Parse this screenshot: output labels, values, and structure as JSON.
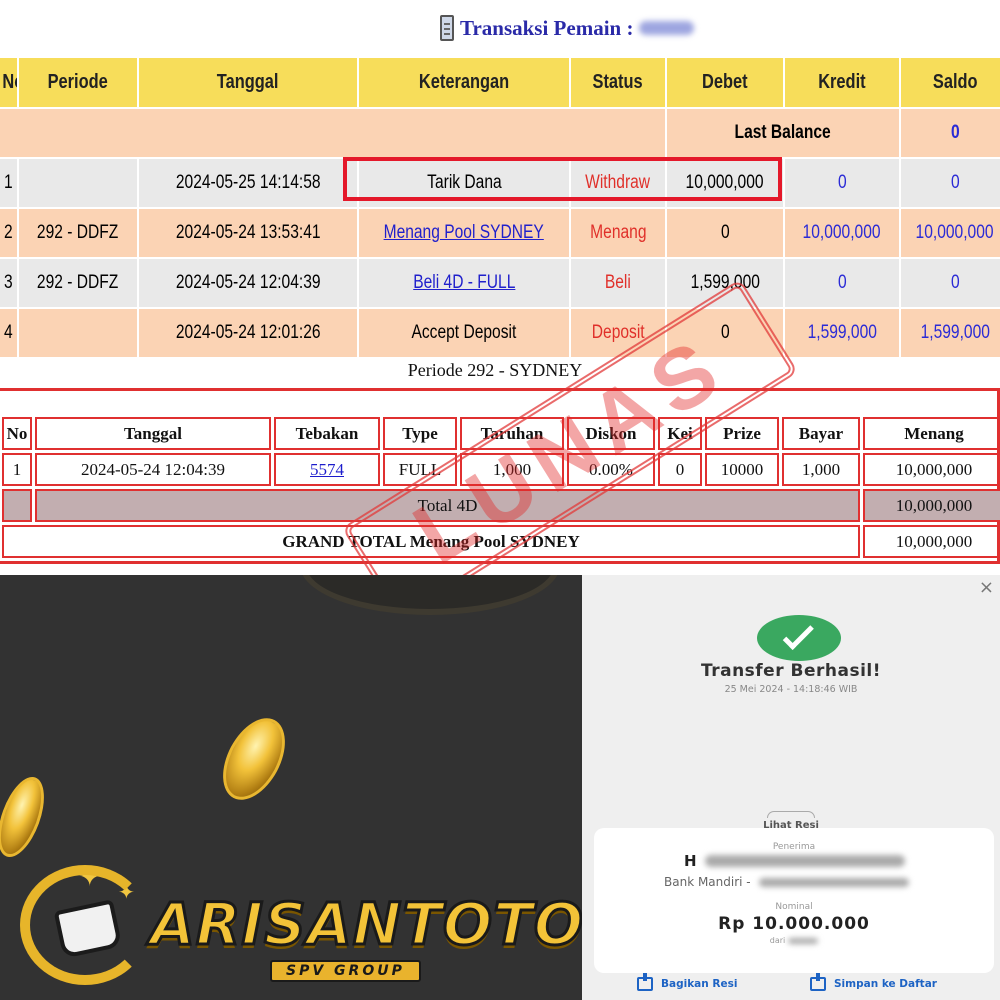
{
  "header": {
    "title": "Transaksi  Pemain :"
  },
  "transactions": {
    "columns": [
      "No",
      "Periode",
      "Tanggal",
      "Keterangan",
      "Status",
      "Debet",
      "Kredit",
      "Saldo"
    ],
    "last_balance_label": "Last Balance",
    "last_balance_value": "0",
    "rows": [
      {
        "no": "1",
        "periode": "",
        "tanggal": "2024-05-25 14:14:58",
        "keterangan": "Tarik Dana",
        "status": "Withdraw",
        "debet": "10,000,000",
        "kredit": "0",
        "saldo": "0"
      },
      {
        "no": "2",
        "periode": "292 - DDFZ",
        "tanggal": "2024-05-24 13:53:41",
        "keterangan": "Menang Pool SYDNEY",
        "status": "Menang",
        "debet": "0",
        "kredit": "10,000,000",
        "saldo": "10,000,000"
      },
      {
        "no": "3",
        "periode": "292 - DDFZ",
        "tanggal": "2024-05-24 12:04:39",
        "keterangan": "Beli 4D - FULL",
        "status": "Beli",
        "debet": "1,599,000",
        "kredit": "0",
        "saldo": "0"
      },
      {
        "no": "4",
        "periode": "",
        "tanggal": "2024-05-24 12:01:26",
        "keterangan": "Accept Deposit",
        "status": "Deposit",
        "debet": "0",
        "kredit": "1,599,000",
        "saldo": "1,599,000"
      }
    ]
  },
  "detail": {
    "title": "Periode 292 - SYDNEY",
    "columns": [
      "No",
      "Tanggal",
      "Tebakan",
      "Type",
      "Taruhan",
      "Diskon",
      "Kei",
      "Prize",
      "Bayar",
      "Menang"
    ],
    "row": {
      "no": "1",
      "tanggal": "2024-05-24 12:04:39",
      "tebakan": "5574",
      "type": "FULL",
      "taruhan": "1,000",
      "diskon": "0.00%",
      "kei": "0",
      "prize": "10000",
      "bayar": "1,000",
      "menang": "10,000,000"
    },
    "total_label": "Total 4D",
    "total_value": "10,000,000",
    "grand_total_label": "GRAND TOTAL  Menang Pool SYDNEY",
    "grand_total_value": "10,000,000"
  },
  "stamp": {
    "text": "LUNAS"
  },
  "promo": {
    "logo_text": "ARISANTOTO",
    "logo_sub": "SPV GROUP"
  },
  "receipt": {
    "close": "×",
    "status_title": "Transfer Berhasil!",
    "status_time": "25 Mei 2024 - 14:18:46 WIB",
    "lihat_resi": "Lihat Resi",
    "penerima_label": "Penerima",
    "recipient_initial": "H",
    "bank": "Bank Mandiri -",
    "nominal_label": "Nominal",
    "amount": "Rp 10.000.000",
    "dari_label": "dari",
    "share_label": "Bagikan Resi",
    "save_label": "Simpan ke Daftar"
  },
  "colors": {
    "header_yellow": "#f7dd5a",
    "row_peach": "#fbd3b4",
    "row_grey": "#e9e9e9",
    "highlight_red": "#e4182a",
    "success_green": "#3aa860",
    "link_blue": "#1d63c4"
  }
}
